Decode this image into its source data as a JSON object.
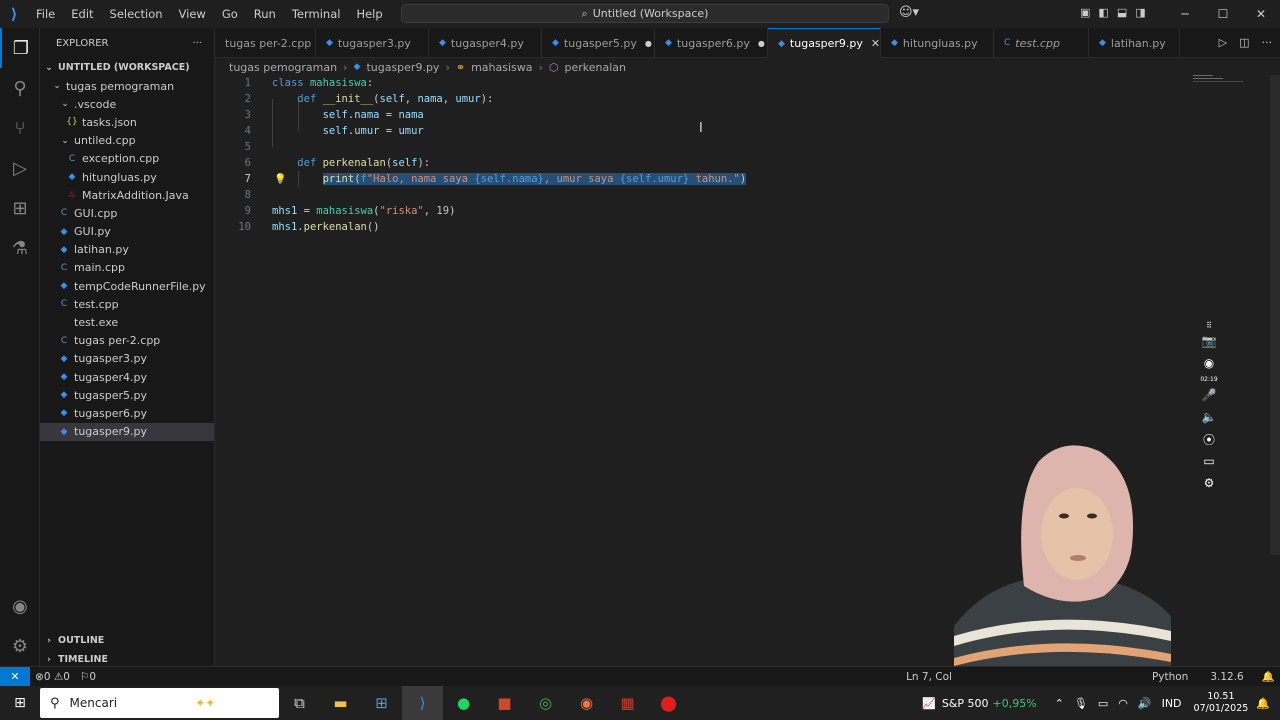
{
  "titlebar": {
    "menu": [
      "File",
      "Edit",
      "Selection",
      "View",
      "Go",
      "Run",
      "Terminal",
      "Help"
    ],
    "search_text": "Untitled (Workspace)"
  },
  "sidebar": {
    "title": "EXPLORER",
    "workspace": "UNTITLED (WORKSPACE)",
    "folder": "tugas pemograman",
    "vscode_folder": ".vscode",
    "tasks_json": "tasks.json",
    "untiled_folder": "untiled.cpp",
    "exception": "exception.cpp",
    "hitungluas": "hitungluas.py",
    "matrix": "MatrixAddition.Java",
    "files": [
      "GUI.cpp",
      "GUI.py",
      "latihan.py",
      "main.cpp",
      "tempCodeRunnerFile.py",
      "test.cpp",
      "test.exe",
      "tugas per-2.cpp",
      "tugasper3.py",
      "tugasper4.py",
      "tugasper5.py",
      "tugasper6.py",
      "tugasper9.py"
    ],
    "outline": "OUTLINE",
    "timeline": "TIMELINE"
  },
  "tabs": [
    "tugas per-2.cpp",
    "tugasper3.py",
    "tugasper4.py",
    "tugasper5.py",
    "tugasper6.py",
    "tugasper9.py",
    "hitungluas.py",
    "test.cpp",
    "latihan.py"
  ],
  "breadcrumb": [
    "tugas pemograman",
    "tugasper9.py",
    "mahasiswa",
    "perkenalan"
  ],
  "editor": {
    "line_numbers": [
      "1",
      "2",
      "3",
      "4",
      "5",
      "6",
      "7",
      "8",
      "9",
      "10"
    ],
    "tokens": {
      "l1_kw": "class",
      "l1_cls": "mahasiswa",
      "l1_p": ":",
      "l2_kw": "def",
      "l2_fn": "__init__",
      "l2_p1": "(",
      "l2_a": "self",
      "l2_c1": ", ",
      "l2_b": "nama",
      "l2_c2": ", ",
      "l2_d": "umur",
      "l2_p2": "):",
      "l3_a": "self",
      "l3_b": ".nama",
      "l3_eq": " = ",
      "l3_c": "nama",
      "l4_a": "self",
      "l4_b": ".umur",
      "l4_eq": " = ",
      "l4_c": "umur",
      "l6_kw": "def",
      "l6_fn": "perkenalan",
      "l6_p1": "(",
      "l6_a": "self",
      "l6_p2": "):",
      "l7_fn": "print",
      "l7_p1": "(",
      "l7_f": "f",
      "l7_s1": "\"Halo, nama saya ",
      "l7_e1": "{self.nama}",
      "l7_s2": ", umur saya ",
      "l7_e2": "{self.umur}",
      "l7_s3": " tahun.\"",
      "l7_p2": ")",
      "l9_a": "mhs1",
      "l9_eq": " = ",
      "l9_cls": "mahasiswa",
      "l9_p1": "(",
      "l9_s": "\"riska\"",
      "l9_c": ", ",
      "l9_n": "19",
      "l9_p2": ")",
      "l10_a": "mhs1",
      "l10_b": ".",
      "l10_fn": "perkenalan",
      "l10_p": "()"
    }
  },
  "recorder": {
    "time": "02:19"
  },
  "statusbar": {
    "errors": "0",
    "warnings": "0",
    "ports": "0",
    "position": "Ln 7, Col",
    "language": "Python",
    "version": "3.12.6"
  },
  "taskbar": {
    "search_placeholder": "Mencari",
    "stock_name": "S&P 500",
    "stock_change": "+0,95%",
    "lang": "IND",
    "time": "10.51",
    "date": "07/01/2025"
  },
  "colors": {
    "accent": "#0078d4",
    "keyword": "#569cd6",
    "class": "#4ec9b0",
    "function": "#dcdcaa",
    "string": "#ce9178",
    "variable": "#9cdcfe",
    "selection": "#264f78"
  }
}
